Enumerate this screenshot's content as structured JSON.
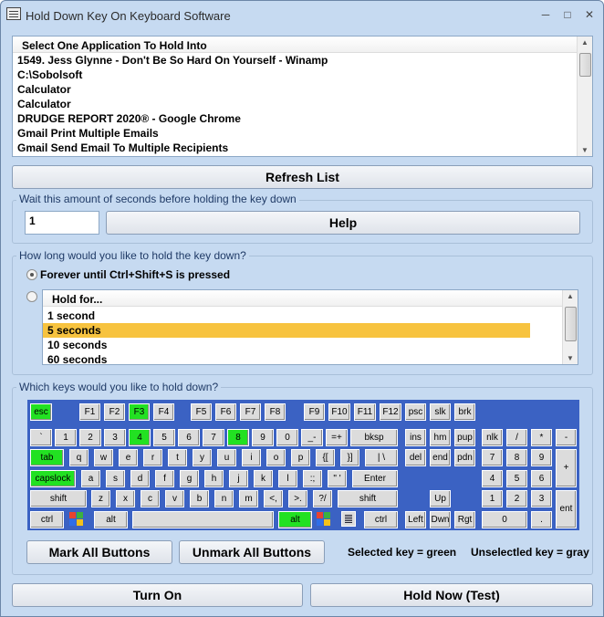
{
  "window": {
    "title": "Hold Down Key On Keyboard Software",
    "minimize": "─",
    "maximize": "□",
    "close": "✕"
  },
  "app_list": {
    "header": "Select One Application To Hold Into",
    "items": [
      "1549. Jess Glynne - Don't Be So Hard On Yourself - Winamp",
      "C:\\Sobolsoft",
      "Calculator",
      "Calculator",
      "DRUDGE REPORT 2020® - Google Chrome",
      "Gmail Print Multiple Emails",
      "Gmail Send Email To Multiple Recipients"
    ]
  },
  "refresh_button": "Refresh List",
  "wait_group": {
    "legend": "Wait this amount of seconds before holding the key down",
    "value": "1",
    "help_button": "Help"
  },
  "duration_group": {
    "legend": "How long would you like to hold the key down?",
    "forever_label": "Forever until Ctrl+Shift+S is pressed",
    "forever_selected": true,
    "hold_for_header": "Hold for...",
    "options": [
      "1 second",
      "5 seconds",
      "10 seconds",
      "60 seconds"
    ],
    "selected_option": "5 seconds"
  },
  "keys_group": {
    "legend": "Which keys would you like to hold down?",
    "keyboard_color": "#3b62c3",
    "active_color": "#22e122",
    "inactive_color": "#dcdcdc",
    "active_keys": [
      "esc",
      "F3",
      "4",
      "8",
      "tab",
      "capslock",
      "alt (right)"
    ],
    "keys": {
      "esc": "esc",
      "f1": "F1",
      "f2": "F2",
      "f3": "F3",
      "f4": "F4",
      "f5": "F5",
      "f6": "F6",
      "f7": "F7",
      "f8": "F8",
      "f9": "F9",
      "f10": "F10",
      "f11": "F11",
      "f12": "F12",
      "psc": "psc",
      "slk": "slk",
      "brk": "brk",
      "backtick": "`",
      "d1": "1",
      "d2": "2",
      "d3": "3",
      "d4": "4",
      "d5": "5",
      "d6": "6",
      "d7": "7",
      "d8": "8",
      "d9": "9",
      "d0": "0",
      "minus": "_-",
      "equals": "=+",
      "bksp": "bksp",
      "ins": "ins",
      "hm": "hm",
      "pup": "pup",
      "nlk": "nlk",
      "npdiv": "/",
      "npmul": "*",
      "npminus": "-",
      "tab": "tab",
      "q": "q",
      "w": "w",
      "e": "e",
      "r": "r",
      "t": "t",
      "y": "y",
      "u": "u",
      "i": "i",
      "o": "o",
      "p": "p",
      "lbr": "{[",
      "rbr": "}]",
      "bslash": "| \\",
      "del": "del",
      "end": "end",
      "pdn": "pdn",
      "np7": "7",
      "np8": "8",
      "np9": "9",
      "npplus": "+",
      "caps": "capslock",
      "a": "a",
      "s": "s",
      "d": "d",
      "f": "f",
      "g": "g",
      "h": "h",
      "j": "j",
      "k": "k",
      "l": "l",
      "semi": ":;",
      "quote": "\" '",
      "enter": "Enter",
      "np4": "4",
      "np5": "5",
      "np6": "6",
      "lshift": "shift",
      "z": "z",
      "x": "x",
      "c": "c",
      "v": "v",
      "b": "b",
      "n": "n",
      "m": "m",
      "comma": "<,",
      "period": ">.",
      "slash": "?/",
      "rshift": "shift",
      "up": "Up",
      "np1": "1",
      "np2": "2",
      "np3": "3",
      "npent": "ent",
      "lctrl": "ctrl",
      "lalt": "alt",
      "ralt": "alt",
      "rctrl": "ctrl",
      "left": "Left",
      "down": "Dwn",
      "right": "Rgt",
      "np0": "0",
      "npdot": "."
    }
  },
  "mark_all_button": "Mark All Buttons",
  "unmark_all_button": "Unmark All Buttons",
  "legend_selected": "Selected key = green",
  "legend_unselected": "Unselectled key = gray",
  "turn_on_button": "Turn On",
  "hold_now_button": "Hold Now (Test)"
}
